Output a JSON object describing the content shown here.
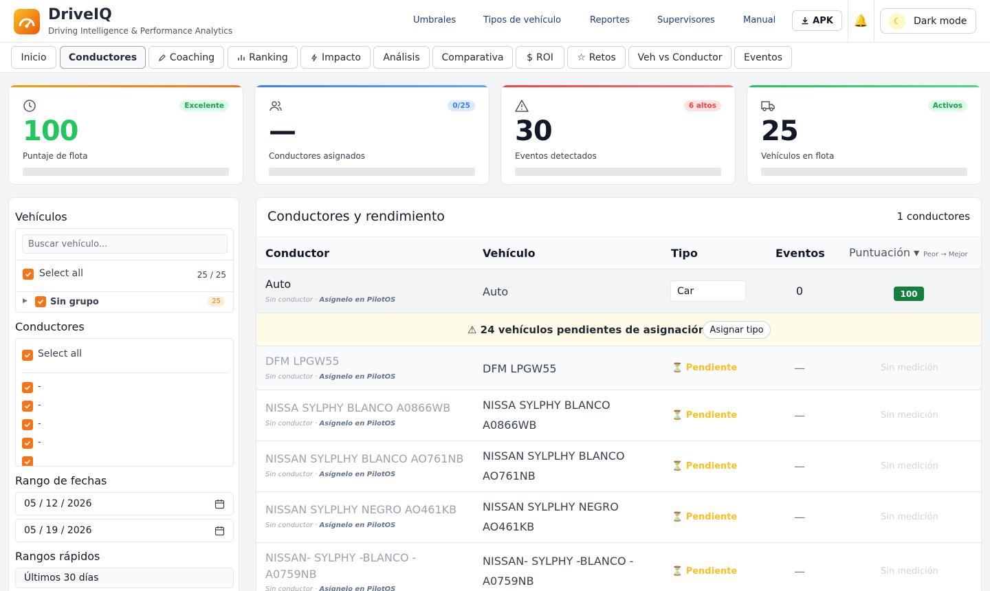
{
  "header": {
    "title": "DriveIQ",
    "subtitle": "Driving Intelligence & Performance Analytics",
    "nav": [
      "Umbrales",
      "Tipos de vehículo",
      "Reportes",
      "Supervisores",
      "Manual"
    ],
    "apk_label": "APK",
    "dark_mode_label": "Dark mode"
  },
  "tabs": [
    "Inicio",
    "Conductores",
    "Coaching",
    "Ranking",
    "Impacto",
    "Análisis",
    "Comparativa",
    "ROI",
    "Retos",
    "Veh vs Conductor",
    "Eventos"
  ],
  "active_tab": "Conductores",
  "kpis": [
    {
      "value": "100",
      "label": "Puntaje de flota",
      "badge": "Excelente",
      "icon": "clock-icon",
      "accent": "#22c55e"
    },
    {
      "value": "—",
      "label": "Conductores asignados",
      "badge": "0/25",
      "icon": "users-icon",
      "accent": "#3b82f6"
    },
    {
      "value": "30",
      "label": "Eventos detectados",
      "badge": "6 altos",
      "icon": "warning-icon",
      "accent": "#ef4444"
    },
    {
      "value": "25",
      "label": "Vehículos en flota",
      "badge": "Activos",
      "icon": "truck-icon",
      "accent": "#22c55e"
    }
  ],
  "sidebar": {
    "vehicles_title": "Vehículos",
    "search_placeholder": "Buscar vehículo...",
    "select_all": "Select all",
    "vehicles_count": "25 / 25",
    "group_name": "Sin grupo",
    "group_count": "25",
    "drivers_title": "Conductores",
    "drivers_select_all": "Select all",
    "drivers": [
      "-",
      "-",
      "-",
      "-"
    ],
    "date_range_title": "Rango de fechas",
    "date_from": "05 / 12 / 2026",
    "date_to": "05 / 19 / 2026",
    "quick_ranges_title": "Rangos rápidos",
    "quick_range_value": "Últimos 30 días"
  },
  "table": {
    "title": "Conductores y rendimiento",
    "count": "1 conductores",
    "headers": {
      "driver": "Conductor",
      "vehicle": "Vehículo",
      "type": "Tipo",
      "events": "Eventos",
      "score": "Puntuación ▾",
      "score_hint": "Peor → Mejor"
    },
    "first_row": {
      "driver": "Auto",
      "sub_prefix": "Sin conductor · ",
      "sub_link": "Asígnelo en PilotOS",
      "vehicle": "Auto",
      "type": "Car",
      "events": "0",
      "score": "100"
    },
    "banner": {
      "text": "⚠ 24 vehículos pendientes de asignación",
      "button": "Asignar tipo"
    },
    "pending_rows": [
      {
        "driver": "DFM LPGW55",
        "vehicle": "DFM LPGW55"
      },
      {
        "driver": "NISSA SYLPHY BLANCO A0866WB",
        "vehicle": "NISSA SYLPHY BLANCO A0866WB"
      },
      {
        "driver": "NISSAN SYLPLHY BLANCO AO761NB",
        "vehicle": "NISSAN SYLPLHY BLANCO AO761NB"
      },
      {
        "driver": "NISSAN SYLPLHY NEGRO AO461KB",
        "vehicle": "NISSAN SYLPLHY NEGRO AO461KB"
      },
      {
        "driver": "NISSAN- SYLPHY -BLANCO - A0759NB",
        "vehicle": "NISSAN- SYLPHY -BLANCO - A0759NB"
      }
    ],
    "pending_sub_prefix": "Sin conductor · ",
    "pending_sub_link": "Asígnelo en PilotOS",
    "pending_label": "⏳ Pendiente",
    "pending_events": "—",
    "pending_score": "Sin medición"
  }
}
